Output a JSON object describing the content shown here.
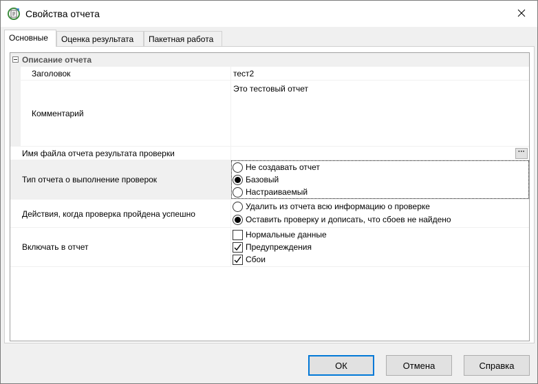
{
  "window": {
    "title": "Свойства отчета",
    "close_glyph": "✕",
    "app_icon": "report-properties-icon",
    "close_icon": "close-icon"
  },
  "tabs": [
    {
      "label": "Основные",
      "active": true
    },
    {
      "label": "Оценка результата",
      "active": false
    },
    {
      "label": "Пакетная работа",
      "active": false
    }
  ],
  "grid": {
    "category": {
      "label": "Описание отчета",
      "expanded": true
    },
    "header": {
      "label": "Заголовок",
      "value": "тест2"
    },
    "comment": {
      "label": "Комментарий",
      "value": "Это тестовый отчет"
    },
    "result_file": {
      "label": "Имя файла отчета результата проверки",
      "value": "",
      "button_label": "···"
    },
    "report_type": {
      "label": "Тип отчета о выполнение проверок",
      "options": [
        "Не создавать отчет",
        "Базовый",
        "Настраиваемый"
      ],
      "selected_index": 1
    },
    "on_success": {
      "label": "Действия, когда проверка пройдена успешно",
      "options": [
        "Удалить из отчета всю информацию о проверке",
        "Оставить проверку и дописать, что сбоев не найдено"
      ],
      "selected_index": 1
    },
    "include": {
      "label": "Включать в отчет",
      "options": [
        "Нормальные данные",
        "Предупреждения",
        "Сбои"
      ],
      "checked": [
        false,
        true,
        true
      ]
    }
  },
  "buttons": {
    "ok": "ОК",
    "cancel": "Отмена",
    "help": "Справка"
  },
  "colors": {
    "focus_border": "#0078d7",
    "category_bg": "#f0f0f0",
    "window_bg": "#f0f0f0"
  }
}
